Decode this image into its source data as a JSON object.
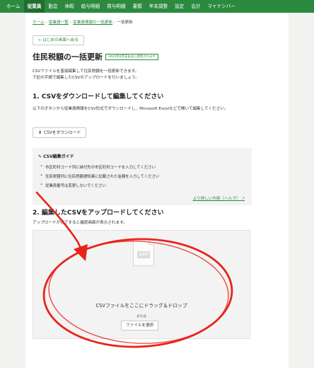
{
  "topnav": {
    "items": [
      {
        "label": "ホーム"
      },
      {
        "label": "従業員"
      },
      {
        "label": "勤怠"
      },
      {
        "label": "休暇"
      },
      {
        "label": "給与明細"
      },
      {
        "label": "賞与明細"
      },
      {
        "label": "書類"
      },
      {
        "label": "年末調整"
      },
      {
        "label": "設定"
      },
      {
        "label": "会計"
      },
      {
        "label": "マイナンバー"
      }
    ],
    "active": "従業員"
  },
  "breadcrumb": {
    "home": "ホーム",
    "employees": "従業員一覧",
    "employee_info": "従業員情報の一括更新",
    "current": "一括更新"
  },
  "back_button": "← はじめの画面へ戻る",
  "page_title": "住民税額の一括更新",
  "deadline_badge": "2020年6月支払分に適用されます",
  "description": {
    "line1": "CSVファイルを直接編集して住民税額を一括更新できます。",
    "line2": "下記の手順で編集したCSVのアップロードを行いましょう。"
  },
  "section1": {
    "title": "1. CSVをダウンロードして編集してください",
    "desc": "以下のボタンから従業員情報をCSV形式でダウンロードし、Microsoft Excelなどで開いて編集してください。",
    "download_button": "CSVをダウンロード",
    "download_icon": "download-icon"
  },
  "guide": {
    "title": "CSV編集ガイド",
    "title_icon": "pencil-icon",
    "items": [
      "市区町村コード列に納付先の市区町村コードを入力してください",
      "住民税額列に住民税額通知書に記載された金額を入力してください",
      "従業員番号は変更しないでください"
    ],
    "help_link": "より詳しい内容（ヘルプ）",
    "external_icon": "external-link-icon"
  },
  "section2": {
    "title": "2. 編集したCSVをアップロードしてください",
    "desc": "アップロードが完了すると確認画面が表示されます。"
  },
  "dropzone": {
    "file_icon_label": "CSV",
    "drop_text": "CSVファイルをここにドラッグ＆ドロップ",
    "or_text": "または",
    "select_button": "ファイルを選択"
  },
  "colors": {
    "brand": "#2b8a3e",
    "annotation": "#e8241c"
  }
}
